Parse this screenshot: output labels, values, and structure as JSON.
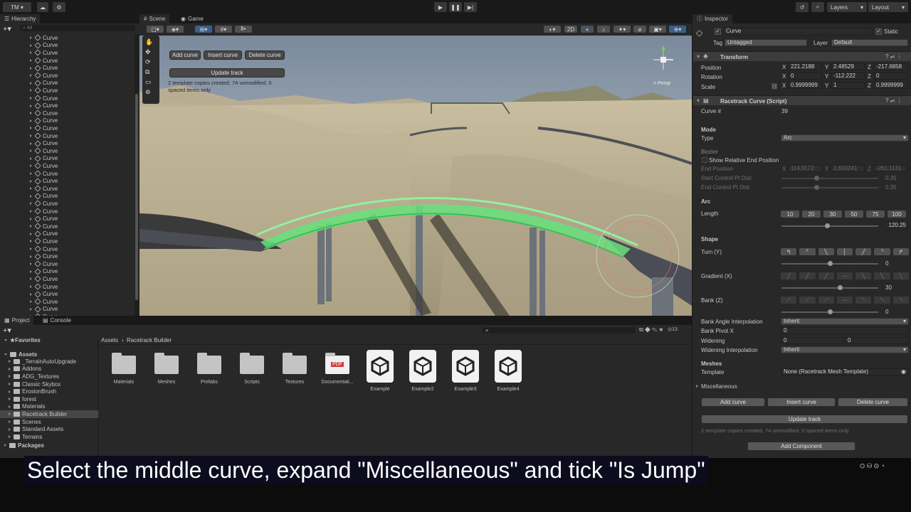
{
  "topbar": {
    "account": "TM",
    "layers": "Layers",
    "layout": "Layout"
  },
  "hierarchy": {
    "tab": "Hierarchy",
    "search_placeholder": "All",
    "item_label": "Curve",
    "items": [
      "Curve",
      "Curve",
      "Curve",
      "Curve",
      "Curve",
      "Curve",
      "Curve",
      "Curve",
      "Curve",
      "Curve",
      "Curve",
      "Curve",
      "Curve",
      "Curve",
      "Curve",
      "Curve",
      "Curve",
      "Curve",
      "Curve",
      "Curve",
      "Curve",
      "Curve",
      "Curve",
      "Curve",
      "Curve",
      "Curve",
      "Curve",
      "Curve",
      "Curve",
      "Curve",
      "Curve",
      "Curve",
      "Curve",
      "Curve",
      "Curve",
      "Curve",
      "Curve",
      "Curve",
      "Curve",
      "Curve",
      "Curve",
      "Curve"
    ],
    "selected_index": 38
  },
  "scene": {
    "tab_scene": "Scene",
    "tab_game": "Game",
    "mode_2d": "2D",
    "persp": "< Persp",
    "overlay": {
      "add_curve": "Add curve",
      "insert_curve": "Insert curve",
      "delete_curve": "Delete curve",
      "update_track": "Update track",
      "status": "2 template copies created, 74 unmodified, 0 spaced items only"
    }
  },
  "project": {
    "tab_project": "Project",
    "tab_console": "Console",
    "badge_count": "13",
    "favorites": "Favorites",
    "assets": "Assets",
    "folders": [
      "_TerrainAutoUpgrade",
      "Addons",
      "ADG_Textures",
      "Classic Skybox",
      "ErosionBrush",
      "forest",
      "Materials",
      "Racetrack Builder",
      "Scenes",
      "Standard Assets",
      "Terrains"
    ],
    "selected_folder": "Racetrack Builder",
    "packages": "Packages",
    "breadcrumb": [
      "Assets",
      "Racetrack Builder"
    ],
    "grid": [
      {
        "name": "Materials",
        "kind": "folder"
      },
      {
        "name": "Meshes",
        "kind": "folder"
      },
      {
        "name": "Prefabs",
        "kind": "folder"
      },
      {
        "name": "Scripts",
        "kind": "folder"
      },
      {
        "name": "Textures",
        "kind": "folder"
      },
      {
        "name": "Documentati...",
        "kind": "pdf"
      },
      {
        "name": "Example",
        "kind": "unity"
      },
      {
        "name": "Example2",
        "kind": "unity"
      },
      {
        "name": "Example3",
        "kind": "unity"
      },
      {
        "name": "Example4",
        "kind": "unity"
      }
    ]
  },
  "inspector": {
    "tab": "Inspector",
    "object_name": "Curve",
    "static": "Static",
    "tag_label": "Tag",
    "tag_value": "Untagged",
    "layer_label": "Layer",
    "layer_value": "Default",
    "transform": {
      "title": "Transform",
      "position_label": "Position",
      "rotation_label": "Rotation",
      "scale_label": "Scale",
      "position": [
        "221.2188",
        "2.48529",
        "-217.6858"
      ],
      "rotation": [
        "0",
        "-112.222",
        "0"
      ],
      "scale": [
        "0.9999999",
        "1",
        "0.9999999"
      ]
    },
    "script": {
      "title": "Racetrack Curve (Script)",
      "curve_num_label": "Curve #",
      "curve_num": "39",
      "mode_section": "Mode",
      "type_label": "Type",
      "type_value": "Arc",
      "bezier_section": "Bezier",
      "show_rel_end": "Show Relative End Position",
      "end_pos_label": "End Position",
      "end_pos": [
        "114.9172",
        "2.610241",
        "-261.1131"
      ],
      "start_ctrl_label": "Start Control Pt Dist",
      "start_ctrl": "0.35",
      "end_ctrl_label": "End Control Pt Dist",
      "end_ctrl": "0.35",
      "arc_section": "Arc",
      "length_label": "Length",
      "length_presets": [
        "10",
        "20",
        "30",
        "50",
        "75",
        "100"
      ],
      "length_value": "120.25",
      "length_fraction": 0.47,
      "shape_section": "Shape",
      "turn_label": "Turn (Y)",
      "turn_value": "0",
      "turn_fraction": 0.5,
      "gradient_label": "Gradient (X)",
      "gradient_value": "30",
      "gradient_fraction": 0.6,
      "bank_label": "Bank (Z)",
      "bank_value": "0",
      "bank_fraction": 0.5,
      "bank_interp_label": "Bank Angle Interpolation",
      "bank_interp_value": "Inherit",
      "bank_pivot_label": "Bank Pivot X",
      "bank_pivot_value": "0",
      "widening_label": "Widening",
      "widening_values": [
        "0",
        "0"
      ],
      "widening_interp_label": "Widening Interpolation",
      "widening_interp_value": "Inherit",
      "meshes_section": "Meshes",
      "template_label": "Template",
      "template_value": "None (Racetrack Mesh Template)",
      "misc_section": "Miscellaneous",
      "add_curve": "Add curve",
      "insert_curve": "Insert curve",
      "delete_curve": "Delete curve",
      "update_track": "Update track",
      "status": "2 template copies created, 74 unmodified, 0 spaced items only"
    },
    "add_component": "Add Component"
  },
  "subtitle": "Select the middle curve, expand \"Miscellaneous\" and tick \"Is Jump\""
}
